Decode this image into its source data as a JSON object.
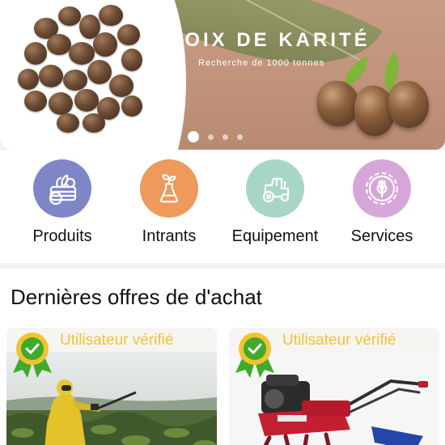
{
  "banner": {
    "title": "NOIX DE KARITÉ",
    "subtitle": "Recherche de 1000 tonnes",
    "slide_count": 4,
    "active_slide": 1
  },
  "categories": [
    {
      "label": "Produits",
      "icon": "vegetable-basket-icon",
      "color": "#7e86c8"
    },
    {
      "label": "Intrants",
      "icon": "seedling-flask-icon",
      "color": "#ed9a5c"
    },
    {
      "label": "Equipement",
      "icon": "tractor-icon",
      "color": "#a8d6c6"
    },
    {
      "label": "Services",
      "icon": "grain-gear-icon",
      "color": "#d7a6d9"
    }
  ],
  "offers": {
    "title": "Dernières offres de d'achat",
    "cards": [
      {
        "verified_label": "Utilisateur vérifié",
        "badge_icon": "verified-award-icon",
        "photo": "crop-spraying-photo"
      },
      {
        "verified_label": "Utilisateur vérifié",
        "badge_icon": "verified-award-icon",
        "photo": "power-tiller-photo"
      }
    ]
  },
  "colors": {
    "banner_bg": "#c79a80",
    "verified_text": "#f0c23a",
    "badge_green": "#3faa2c"
  }
}
